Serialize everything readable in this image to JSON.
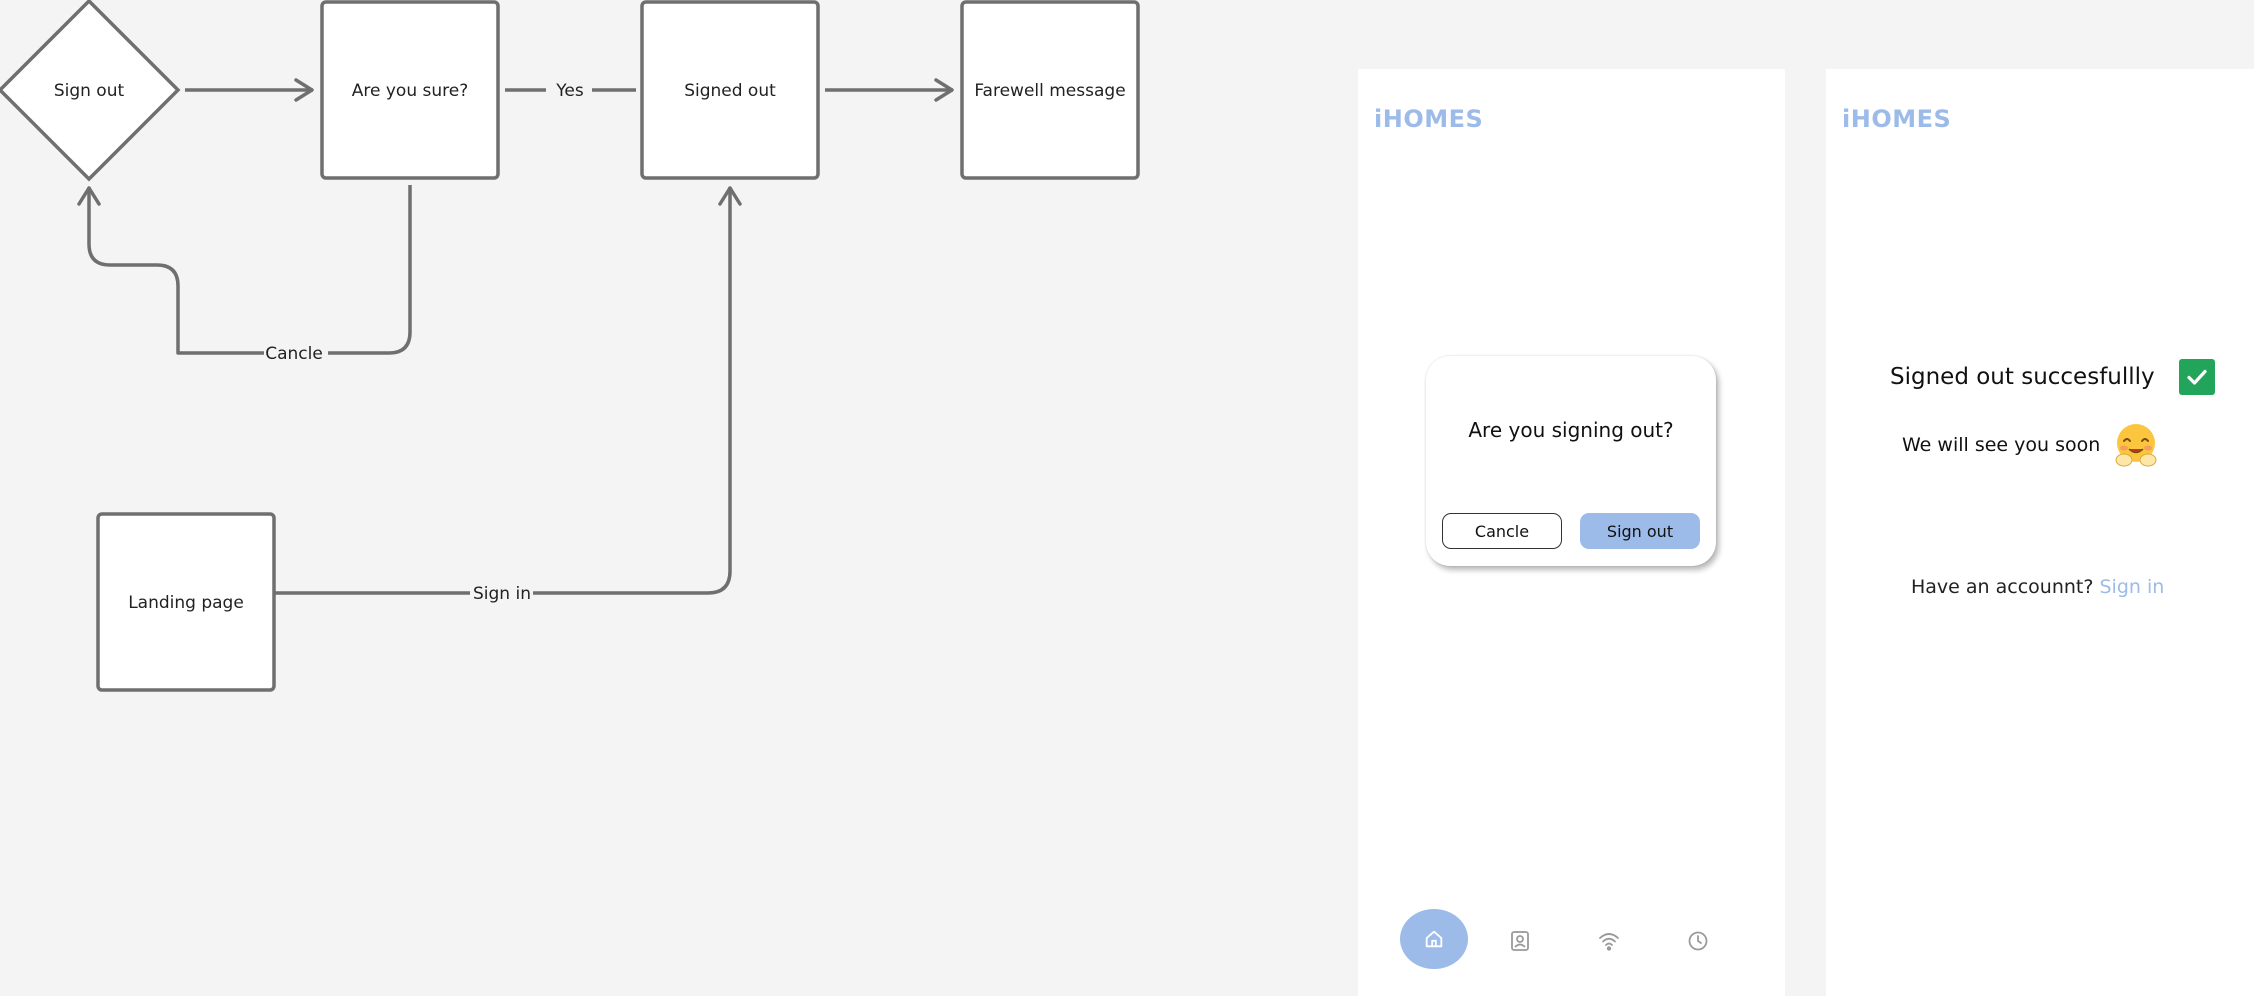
{
  "flowchart": {
    "nodes": {
      "sign_out": "Sign out",
      "are_you_sure": "Are you sure?",
      "signed_out": "Signed out",
      "farewell": "Farewell message",
      "landing": "Landing page"
    },
    "edges": {
      "yes": "Yes",
      "cancel": "Cancle",
      "sign_in": "Sign in"
    }
  },
  "screen_confirm": {
    "brand": "iHOMES",
    "dialog": {
      "title": "Are you signing out?",
      "cancel_label": "Cancle",
      "sign_out_label": "Sign out"
    },
    "nav_icons": [
      "home-icon",
      "contacts-icon",
      "wifi-icon",
      "clock-icon"
    ]
  },
  "screen_done": {
    "brand": "iHOMES",
    "success_message": "Signed out succesfullly",
    "farewell_message": "We will see you soon",
    "account_prompt": "Have an accounnt?",
    "sign_in_link": "Sign in",
    "check_icon": "check-icon",
    "emoji_icon": "hugging-face-emoji"
  },
  "colors": {
    "background": "#f4f4f4",
    "node_stroke": "#6f6f6f",
    "accent": "#9cbbe9",
    "success": "#22a55a"
  }
}
